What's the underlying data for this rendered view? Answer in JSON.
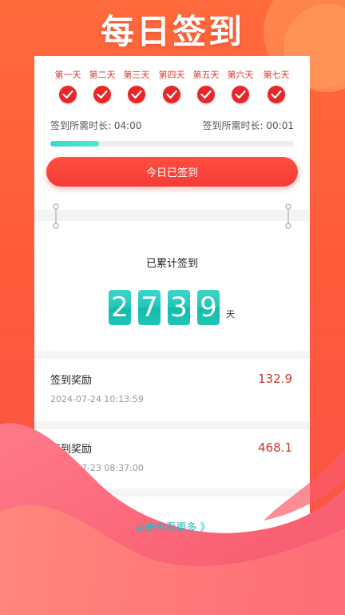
{
  "header": {
    "title": "每日签到"
  },
  "days": [
    {
      "label": "第一天",
      "checked": true
    },
    {
      "label": "第二天",
      "checked": true
    },
    {
      "label": "第三天",
      "checked": true
    },
    {
      "label": "第四天",
      "checked": true
    },
    {
      "label": "第五天",
      "checked": true
    },
    {
      "label": "第六天",
      "checked": true
    },
    {
      "label": "第七天",
      "checked": true
    }
  ],
  "time": {
    "left_text": "签到所需时长: 04:00",
    "right_text": "签到所需时长:  00:01",
    "progress": 0.2
  },
  "button": {
    "label": "今日已签到"
  },
  "total": {
    "label": "已累计签到",
    "digits": [
      "2",
      "7",
      "3",
      "9"
    ],
    "unit": "天"
  },
  "records": [
    {
      "title": "签到奖励",
      "time": "2024-07-24 10:13:59",
      "amount": "132.9"
    },
    {
      "title": "签到奖励",
      "time": "2024-07-23 08:37:00",
      "amount": "468.1"
    }
  ],
  "more": {
    "label": "点击查看更多 》"
  },
  "colors": {
    "accent": "#e8272a",
    "digit": "#1fc7b8",
    "link": "#21b9c4",
    "amount": "#c9372c"
  }
}
